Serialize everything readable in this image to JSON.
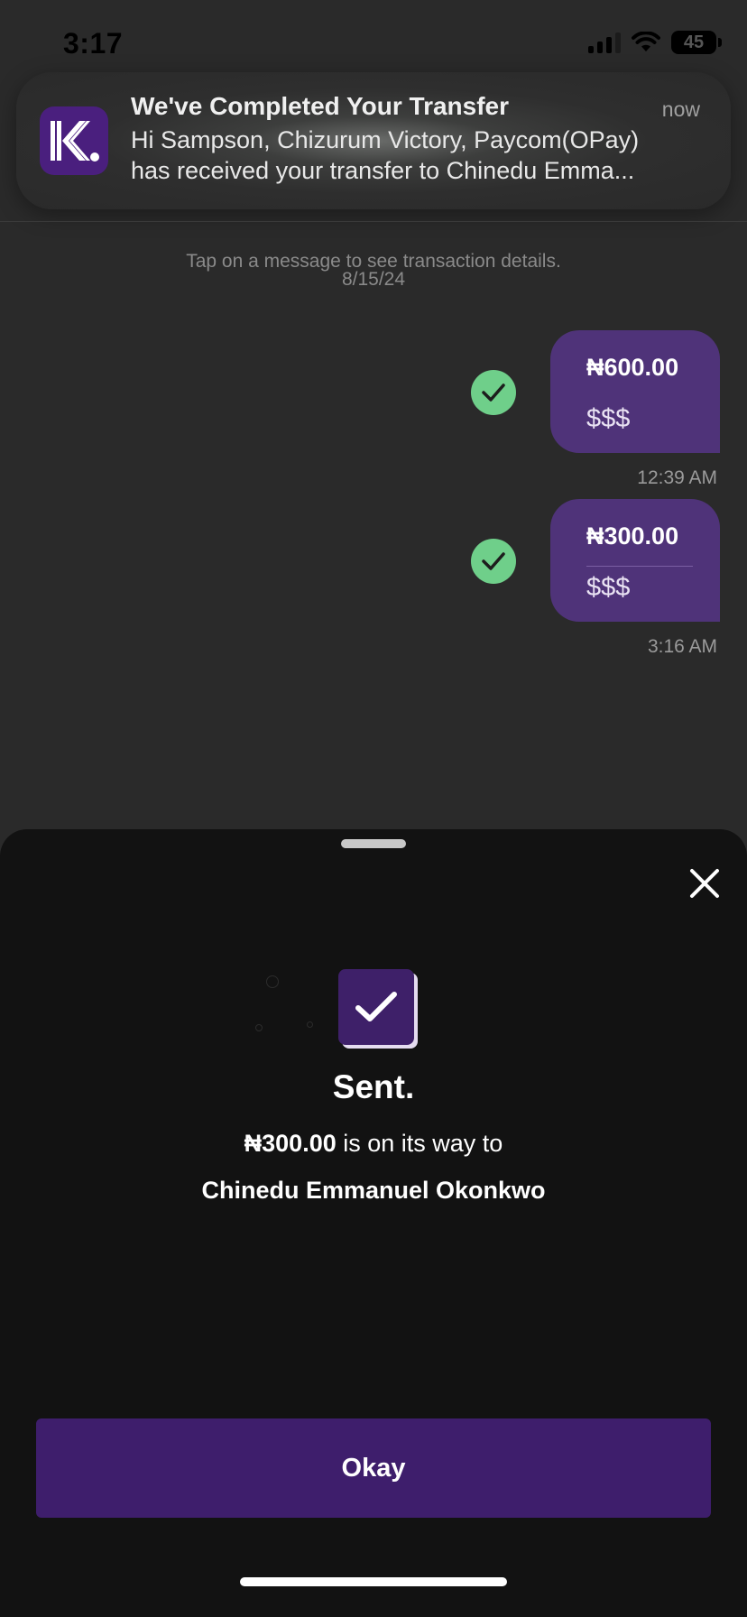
{
  "status_bar": {
    "time": "3:17",
    "battery": "45"
  },
  "notification": {
    "title": "We've Completed Your Transfer",
    "time": "now",
    "body_line1": "Hi Sampson, Chizurum Victory, Paycom(OPay)",
    "body_line2": "has received your transfer to Chinedu Emma..."
  },
  "chat": {
    "hint": "Tap on a message to see transaction details.",
    "date": "8/15/24",
    "messages": [
      {
        "amount": "₦600.00",
        "note": "$$$",
        "time": "12:39 AM"
      },
      {
        "amount": "₦300.00",
        "note": "$$$",
        "time": "3:16 AM"
      }
    ]
  },
  "sheet": {
    "title": "Sent.",
    "amount": "₦300.00",
    "message_suffix": " is on its way to",
    "recipient": "Chinedu Emmanuel Okonkwo",
    "button_label": "Okay"
  },
  "colors": {
    "brand_purple": "#3e1e6c",
    "bubble_purple": "#4f3379",
    "check_green": "#6fcf8a",
    "sheet_bg": "#121212"
  },
  "icons": [
    "app-logo-icon",
    "check-circle-icon",
    "close-icon",
    "success-check-icon",
    "signal-icon",
    "wifi-icon",
    "battery-icon"
  ]
}
